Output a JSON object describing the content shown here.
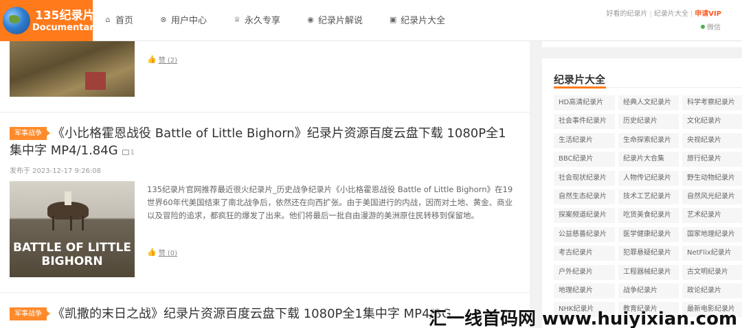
{
  "header": {
    "logo": {
      "title": "135纪录片",
      "subtitle": "Documentary"
    },
    "nav": [
      {
        "label": "首页",
        "icon": "home-icon",
        "glyph": "⌂"
      },
      {
        "label": "用户中心",
        "icon": "user-center-icon",
        "glyph": "⊗"
      },
      {
        "label": "永久专享",
        "icon": "trophy-icon",
        "glyph": "♕"
      },
      {
        "label": "纪录片解说",
        "icon": "broadcast-icon",
        "glyph": "◉"
      },
      {
        "label": "纪录片大全",
        "icon": "list-icon",
        "glyph": "▣"
      }
    ],
    "right_links": [
      "好看的纪录片",
      "纪录片大全"
    ],
    "vip_label": "申请VIP",
    "wechat_label": "微信"
  },
  "posts": {
    "prev": {
      "likes": "赞 (2)"
    },
    "post1": {
      "category": "军事战争",
      "title": "《小比格霍恩战役 Battle of Little Bighorn》纪录片资源百度云盘下载 1080P全1集中字 MP4/1.84G",
      "image_count": "1",
      "date": "发布于 2023-12-17 9:26:08",
      "thumbnail_text": "BATTLE OF LITTLE BIGHORN",
      "excerpt": "135纪录片官网推荐最近很火纪录片_历史战争纪录片《小比格霍恩战役 Battle of Little Bighorn》在19世界60年代美国结束了南北战争后，依然还在向西扩张。由于美国进行的内战，因而对土地、黄金、商业以及冒险的追求，都疯狂的爆发了出来。他们将最后一批自由漫游的美洲原住民转移到保留地。",
      "likes": "赞 (0)"
    },
    "post2": {
      "category": "军事战争",
      "title": "《凯撒的末日之战》纪录片资源百度云盘下载 1080P全1集中字 MP4/3G"
    }
  },
  "sidebar": {
    "title": "纪录片大全",
    "tags": [
      "HD高清纪录片",
      "经典人文纪录片",
      "科学考察纪录片",
      "社会事件纪录片",
      "历史纪录片",
      "文化纪录片",
      "生活纪录片",
      "生命探索纪录片",
      "央视纪录片",
      "BBC纪录片",
      "纪录片大合集",
      "旅行纪录片",
      "社会现状纪录片",
      "人物传记纪录片",
      "野生动物纪录片",
      "自然生态纪录片",
      "技术工艺纪录片",
      "自然风光纪录片",
      "探案频道纪录片",
      "吃货美食纪录片",
      "艺术纪录片",
      "公益慈善纪录片",
      "医学健康纪录片",
      "国家地理纪录片",
      "考古纪录片",
      "犯罪悬疑纪录片",
      "NetFlix纪录片",
      "户外纪录片",
      "工程器械纪录片",
      "古文明纪录片",
      "地理纪录片",
      "战争纪录片",
      "政论纪录片",
      "NHK纪录片",
      "教育纪录片",
      "最新电影纪录片"
    ]
  },
  "watermark": "汇一线首码网 www.huiyixian.com"
}
